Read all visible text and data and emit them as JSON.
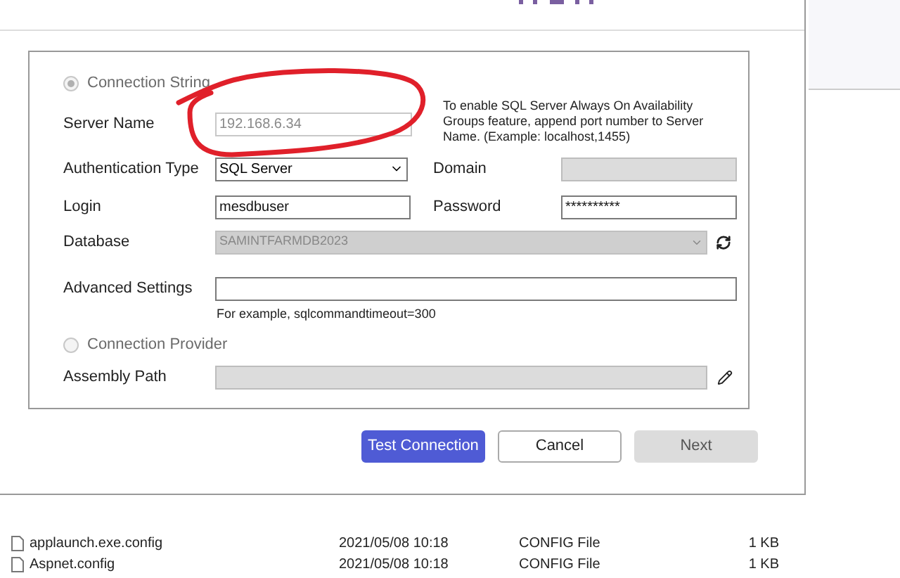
{
  "connection_modes": [
    {
      "label": "Connection String",
      "selected": true,
      "disabled": true
    },
    {
      "label": "Connection Provider",
      "selected": false,
      "disabled": true
    }
  ],
  "server_name": {
    "label": "Server Name",
    "value": "192.168.6.34",
    "disabled": true
  },
  "server_hint": "To enable SQL Server Always On Availability Groups feature, append port number to Server Name. (Example: localhost,1455)",
  "authentication_type": {
    "label": "Authentication Type",
    "value": "SQL Server"
  },
  "domain": {
    "label": "Domain",
    "disabled": true
  },
  "login": {
    "label": "Login",
    "value": "mesdbuser"
  },
  "password": {
    "label": "Password",
    "value": "**********"
  },
  "database": {
    "label": "Database",
    "value": "SAMINTFARMDB2023",
    "disabled": true
  },
  "advanced_settings": {
    "label": "Advanced Settings",
    "hint": "For example, sqlcommandtimeout=300"
  },
  "assembly_path": {
    "label": "Assembly Path",
    "disabled": true
  },
  "buttons": [
    {
      "label": "Test Connection",
      "kind": "primary",
      "disabled": false
    },
    {
      "label": "Cancel",
      "kind": "secondary",
      "disabled": false
    },
    {
      "label": "Next",
      "kind": "secondary",
      "disabled": true
    }
  ],
  "files": [
    {
      "name": "applaunch.exe.config",
      "date": "2021/05/08 10:18",
      "type": "CONFIG File",
      "size": "1 KB"
    },
    {
      "name": "Aspnet.config",
      "date": "2021/05/08 10:18",
      "type": "CONFIG File",
      "size": "1 KB"
    }
  ]
}
